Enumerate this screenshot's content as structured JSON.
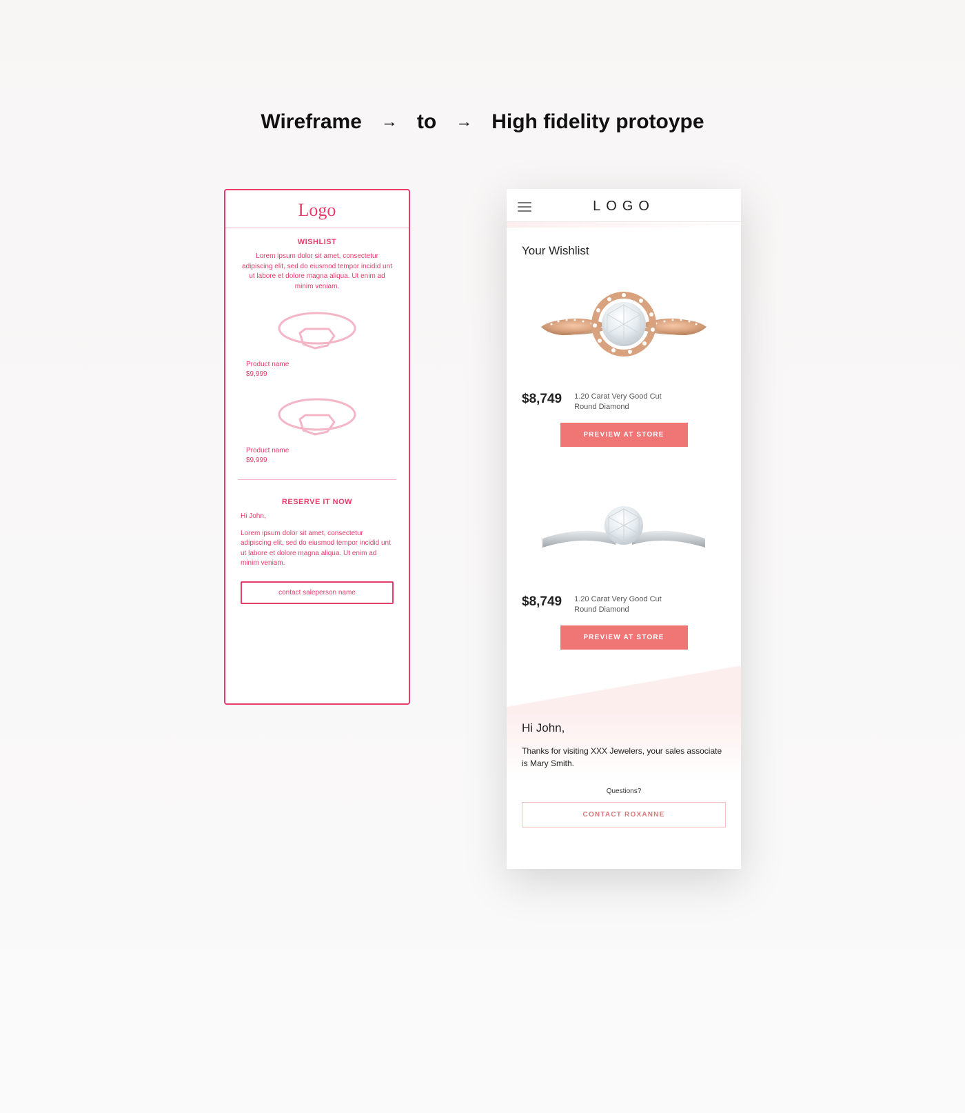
{
  "heading": {
    "left": "Wireframe",
    "mid": "to",
    "right": "High fidelity protoype",
    "arrow": "→"
  },
  "wireframe": {
    "logo": "Logo",
    "wishlist_title": "WISHLIST",
    "lorem": "Lorem ipsum dolor sit amet, consectetur adipiscing elit, sed do eiusmod tempor incidid unt ut labore et dolore magna aliqua. Ut enim ad minim veniam.",
    "products": [
      {
        "name": "Product name",
        "price": "$9,999"
      },
      {
        "name": "Product name",
        "price": "$9,999"
      }
    ],
    "reserve_title": "RESERVE IT NOW",
    "greeting": "Hi John,",
    "contact_button": "contact saleperson name"
  },
  "hifi": {
    "logo": "LOGO",
    "wishlist_title": "Your Wishlist",
    "products": [
      {
        "price": "$8,749",
        "desc": "1.20 Carat Very Good Cut Round Diamond",
        "cta": "PREVIEW AT STORE"
      },
      {
        "price": "$8,749",
        "desc": "1.20 Carat Very Good Cut Round Diamond",
        "cta": "PREVIEW AT STORE"
      }
    ],
    "greeting": "Hi John,",
    "contact_body": "Thanks for visiting XXX Jewelers, your sales associate is Mary Smith.",
    "questions_label": "Questions?",
    "contact_button": "CONTACT ROXANNE"
  }
}
